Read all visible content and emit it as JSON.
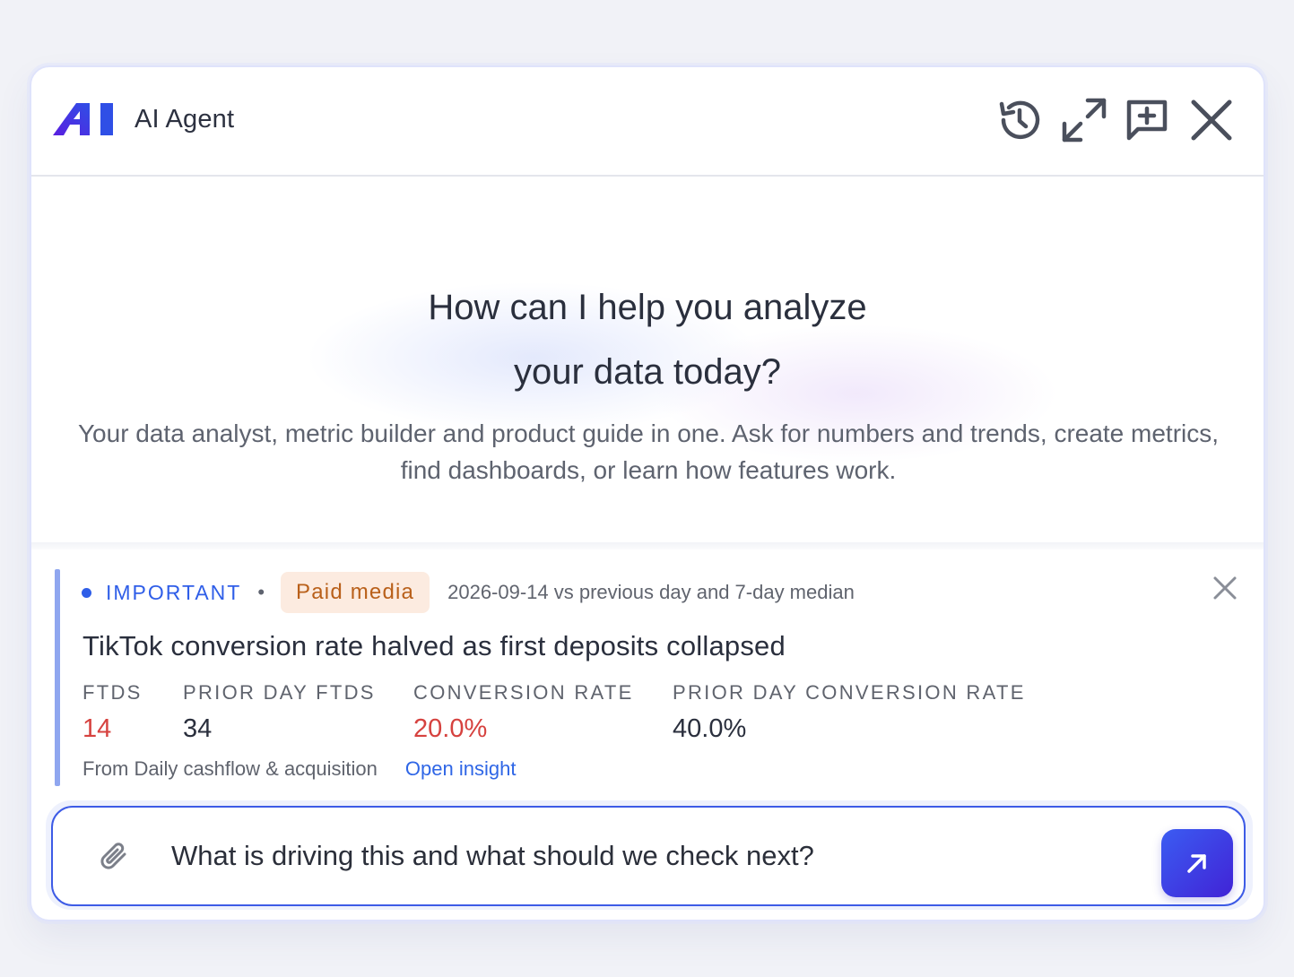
{
  "header": {
    "title": "AI Agent",
    "logo_icon": "ai-logo-icon",
    "actions": [
      {
        "name": "history",
        "icon": "history-icon"
      },
      {
        "name": "expand",
        "icon": "expand-icon"
      },
      {
        "name": "new-chat",
        "icon": "new-chat-icon"
      },
      {
        "name": "close",
        "icon": "close-icon"
      }
    ]
  },
  "hero": {
    "title_line1": "How can I help you analyze",
    "title_line2": "your data today?",
    "subtitle": "Your data analyst, metric builder and product guide in one. Ask for numbers and trends, create metrics, find dashboards, or learn how features work."
  },
  "insight": {
    "priority": "IMPORTANT",
    "separator": "•",
    "category": "Paid media",
    "comparison": "2026-09-14 vs previous day and 7-day median",
    "title": "TikTok conversion rate halved as first deposits collapsed",
    "metrics": [
      {
        "label": "FTDS",
        "value": "14",
        "status": "negative"
      },
      {
        "label": "PRIOR DAY FTDS",
        "value": "34",
        "status": "neutral"
      },
      {
        "label": "CONVERSION RATE",
        "value": "20.0%",
        "status": "negative"
      },
      {
        "label": "PRIOR DAY CONVERSION RATE",
        "value": "40.0%",
        "status": "neutral"
      }
    ],
    "source": "From Daily cashflow & acquisition",
    "link_label": "Open insight"
  },
  "composer": {
    "value": "What is driving this and what should we check next?",
    "attach_icon": "paperclip-icon",
    "send_icon": "arrow-up-right-icon"
  },
  "colors": {
    "accent": "#2f5ee8",
    "negative": "#d6423f",
    "badge_bg": "#fcebe0",
    "badge_text": "#b9601a",
    "send_gradient_start": "#3b5cf2",
    "send_gradient_end": "#4123d6"
  }
}
